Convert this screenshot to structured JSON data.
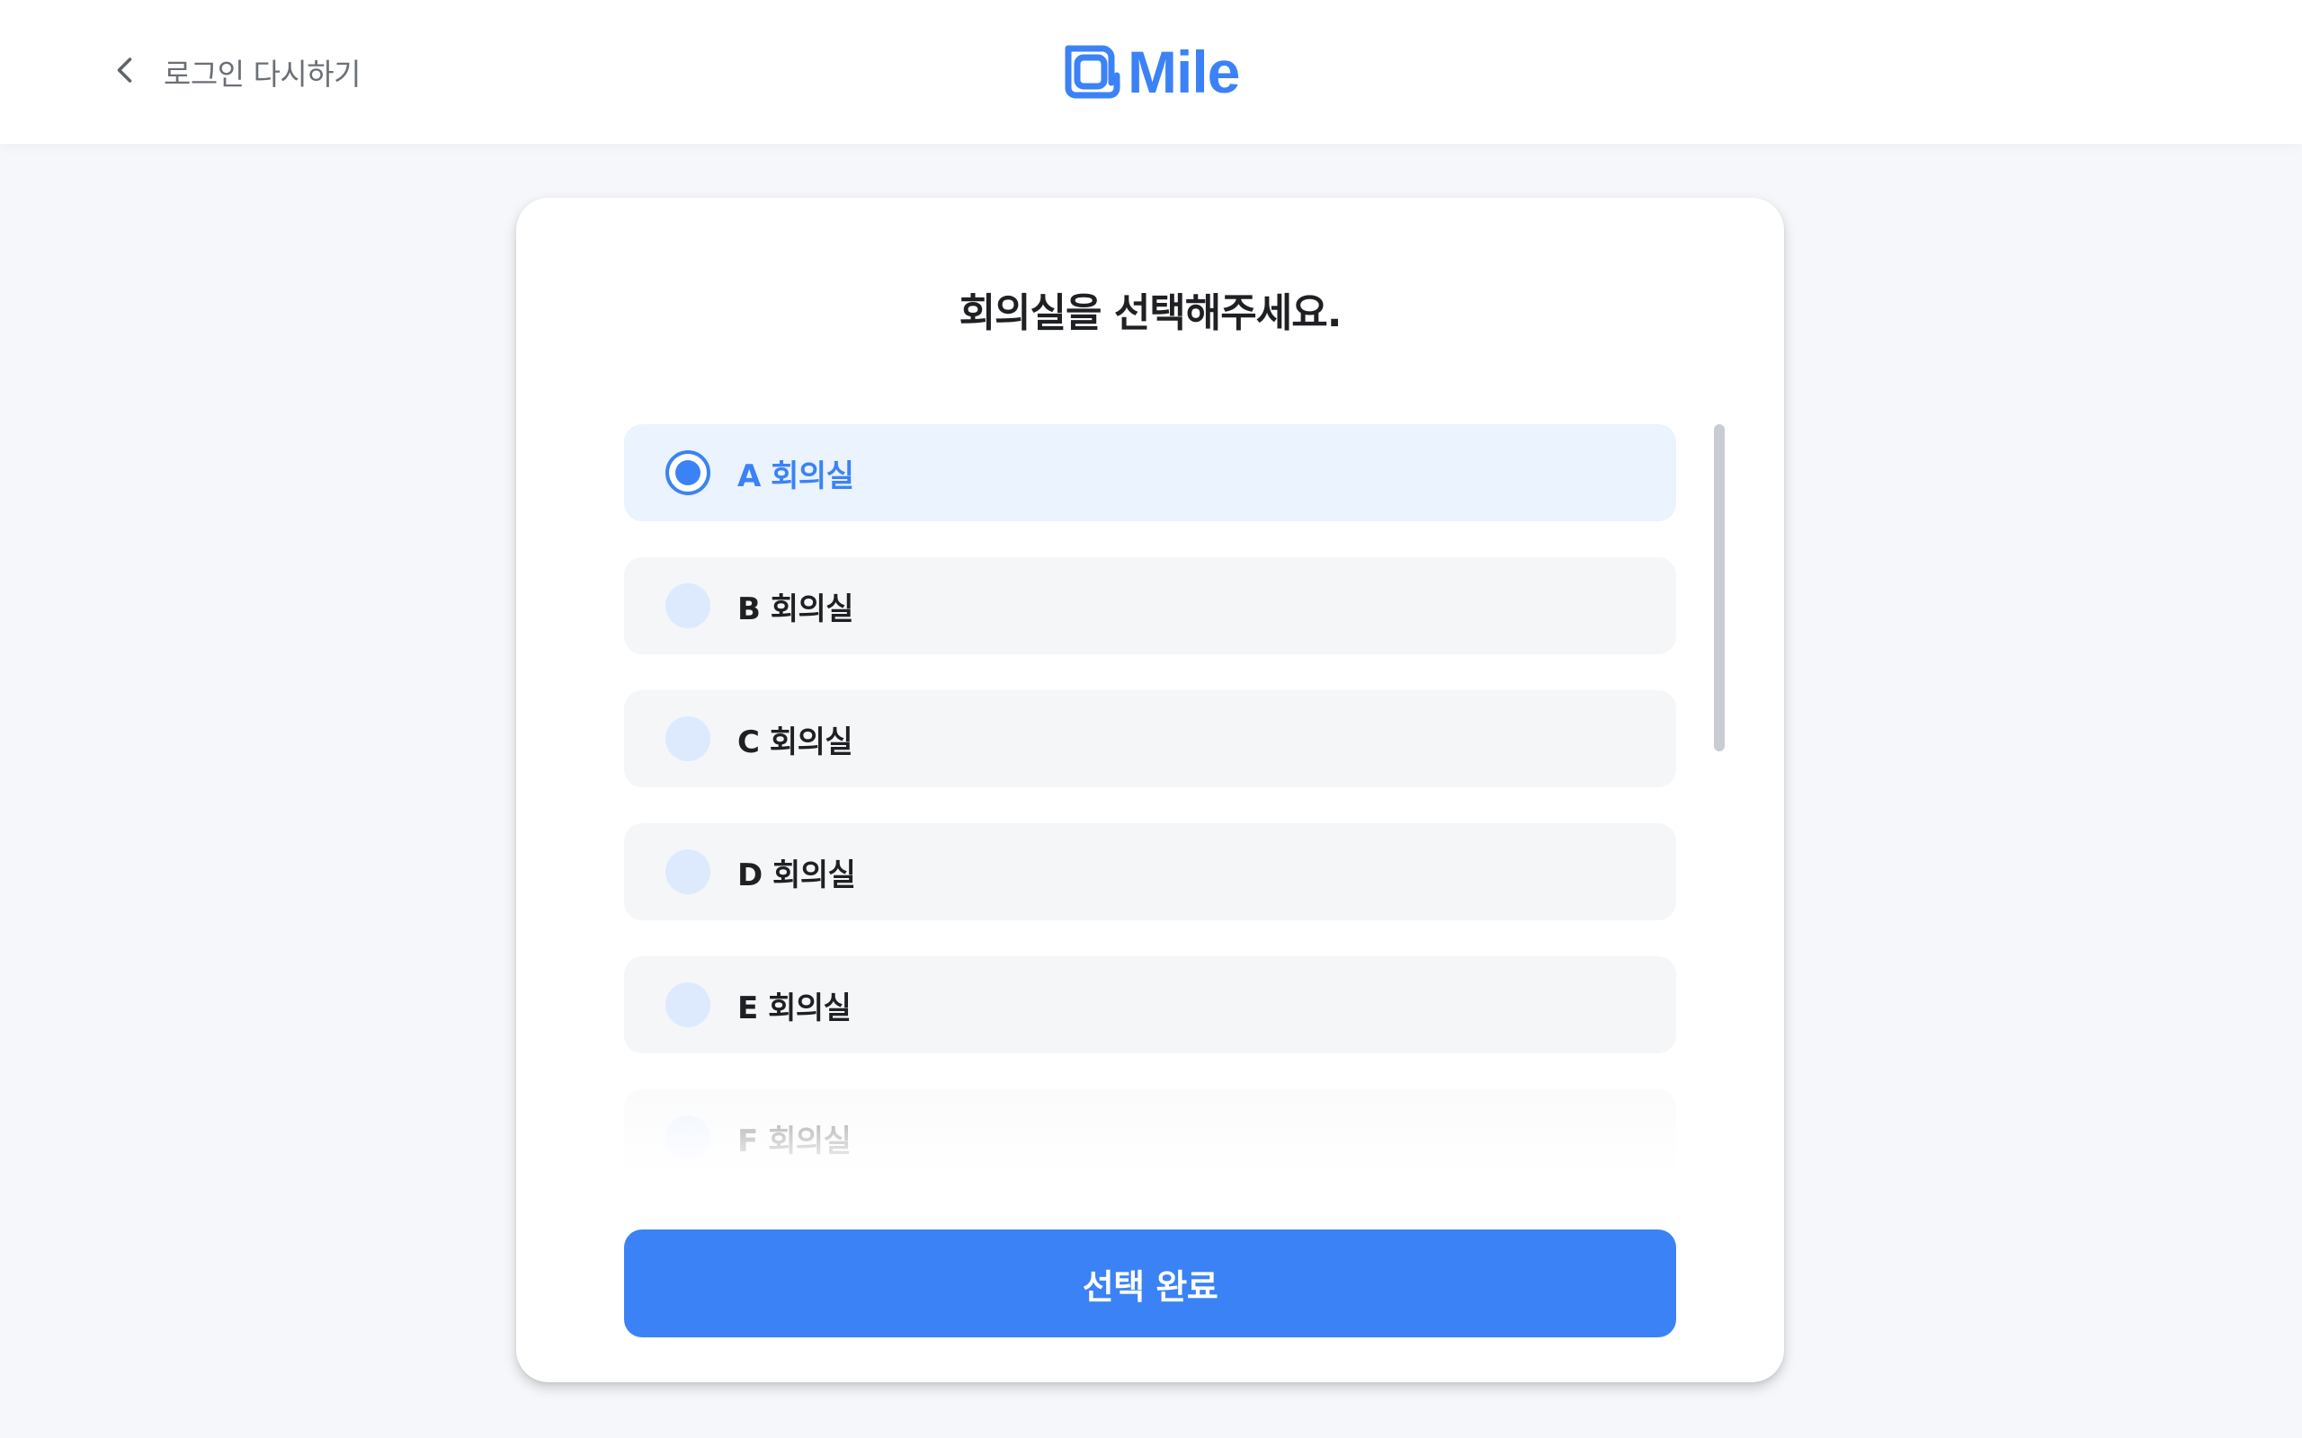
{
  "header": {
    "back_label": "로그인 다시하기",
    "logo_text": "Mile"
  },
  "card": {
    "title": "회의실을 선택해주세요.",
    "options": [
      {
        "label": "A 회의실",
        "selected": true
      },
      {
        "label": "B 회의실",
        "selected": false
      },
      {
        "label": "C 회의실",
        "selected": false
      },
      {
        "label": "D 회의실",
        "selected": false
      },
      {
        "label": "E 회의실",
        "selected": false
      },
      {
        "label": "F 회의실",
        "selected": false
      }
    ],
    "submit_label": "선택 완료"
  },
  "colors": {
    "accent": "#3b82f6",
    "selected_bg": "#eaf3fe",
    "option_bg": "#f5f6f8",
    "page_bg": "#f5f7fa"
  }
}
